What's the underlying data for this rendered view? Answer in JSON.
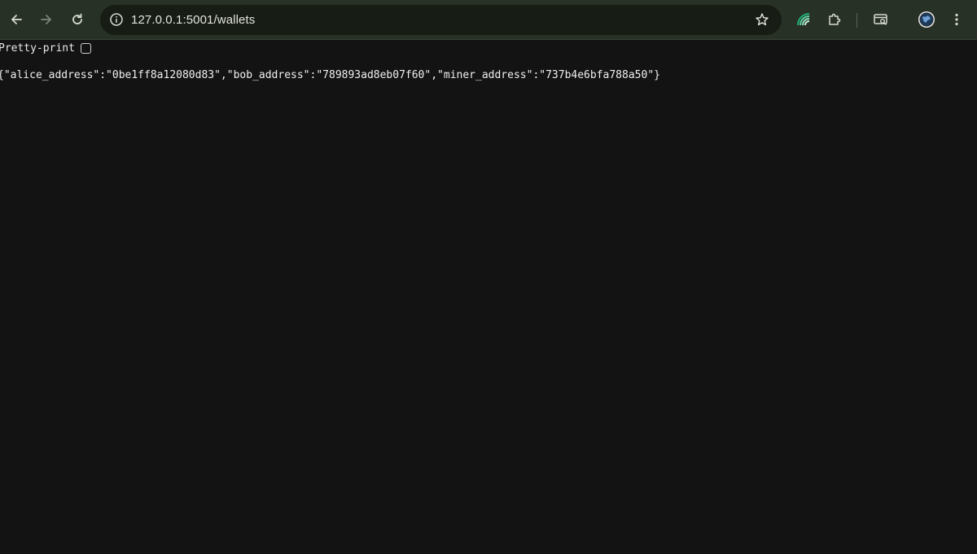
{
  "browser": {
    "url": "127.0.0.1:5001/wallets",
    "icons": {
      "back": "back-arrow-icon",
      "forward": "forward-arrow-icon",
      "reload": "reload-icon",
      "site_info": "info-icon",
      "bookmark": "star-icon",
      "extension_1": "grammarly-swirl-icon",
      "extensions": "puzzle-icon",
      "tab_search": "tab-search-icon",
      "profile": "profile-avatar-icon",
      "menu": "kebab-menu-icon"
    },
    "colors": {
      "toolbar_bg": "#283126",
      "omnibox_bg": "#171c15",
      "page_bg": "#131313"
    }
  },
  "page": {
    "pretty_print_label": "Pretty-print",
    "pretty_print_checked": false,
    "json_body": "{\"alice_address\":\"0be1ff8a12080d83\",\"bob_address\":\"789893ad8eb07f60\",\"miner_address\":\"737b4e6bfa788a50\"}"
  }
}
